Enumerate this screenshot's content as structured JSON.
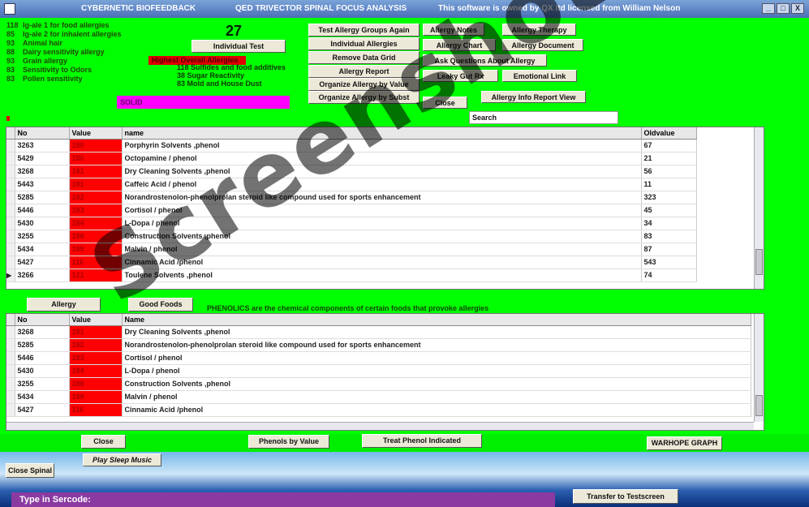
{
  "titlebar": {
    "app_name": "CYBERNETIC BIOFEEDBACK",
    "module": "QED   TRIVECTOR SPINAL FOCUS ANALYSIS",
    "license": "This software is owned by QX ltd licensed from William Nelson",
    "controls": [
      "_",
      "□",
      "X"
    ]
  },
  "stats": [
    {
      "num": "118",
      "label": "Ig-ale 1 for food allergies"
    },
    {
      "num": "85",
      "label": "Ig-ale 2 for inhalent allergies"
    },
    {
      "num": "93",
      "label": "Animal hair"
    },
    {
      "num": "88",
      "label": "Dairy sensitivity allergy"
    },
    {
      "num": "93",
      "label": "Grain allergy"
    },
    {
      "num": "83",
      "label": "Sensitivity to Odors"
    },
    {
      "num": "83",
      "label": "Pollen sensitivity"
    }
  ],
  "count": "27",
  "red_label": "Highest Overall Allergies",
  "subs": [
    {
      "num": "118",
      "label": "Sulfides and food additives"
    },
    {
      "num": "38",
      "label": "Sugar Reactivity"
    },
    {
      "num": "83",
      "label": "Mold and House Dust"
    }
  ],
  "magenta_text": "SOLID",
  "buttons": {
    "individual_test": "Individual Test",
    "test_allergy_groups": "Test Allergy Groups Again",
    "individual_allergies": "Individual Allergies",
    "remove_data_grid": "Remove Data Grid",
    "allergy_report": "Allergy Report",
    "organize_by_value": "Organize Allergy by Value",
    "organize_by_subst": "Organize Allergy by Subst",
    "allergy_notes": "Allergy Notes",
    "allergy_therapy": "Allergy Therapy",
    "allergy_chart": "Allergy Chart",
    "allergy_document": "Allergy Document",
    "ask_questions": "Ask Questions About Allergy",
    "leaky_gut": "Leaky Gut Rx",
    "emotional_link": "Emotional Link",
    "close_top": "Close",
    "allergy_info_report": "Allergy Info Report View",
    "allergy_tab": "Allergy",
    "good_foods_tab": "Good Foods",
    "close_bottom": "Close",
    "phenols_by_value": "Phenols by Value",
    "treat_phenol": "Treat Phenol Indicated",
    "warhope_graph": "WARHOPE GRAPH",
    "play_sleep_music": "Play Sleep Music",
    "close_spinal": "Close Spinal",
    "transfer": "Transfer to Testscreen"
  },
  "search": {
    "value": "Search"
  },
  "top_grid": {
    "headers": [
      "No",
      "Value",
      "name",
      "Oldvalue"
    ],
    "rows": [
      {
        "no": "3263",
        "value": "180",
        "name": "Porphyrin Solvents      ,phenol",
        "old": "67"
      },
      {
        "no": "5429",
        "value": "180",
        "name": "Octopamine /  phenol",
        "old": "21"
      },
      {
        "no": "3268",
        "value": "181",
        "name": "Dry Cleaning Solvents      ,phenol",
        "old": "56"
      },
      {
        "no": "5443",
        "value": "181",
        "name": "Caffeic Acid /  phenol",
        "old": "11"
      },
      {
        "no": "5285",
        "value": "182",
        "name": "Norandrostenolon-phenolprolan    steroid like compound used for sports enhancement",
        "old": "323"
      },
      {
        "no": "5446",
        "value": "183",
        "name": "Cortisol /  phenol",
        "old": "45"
      },
      {
        "no": "5430",
        "value": "184",
        "name": "L-Dopa /  phenol",
        "old": "34"
      },
      {
        "no": "3255",
        "value": "186",
        "name": "Construction Solvents      ,phenol",
        "old": "83"
      },
      {
        "no": "5434",
        "value": "189",
        "name": "Malvin /  phenol",
        "old": "87"
      },
      {
        "no": "5427",
        "value": "116",
        "name": "Cinnamic Acid /phenol",
        "old": "543"
      },
      {
        "no": "3266",
        "value": "121",
        "name": "Toulene Solvents      ,phenol",
        "old": "74"
      }
    ]
  },
  "phenolics_msg": "PHENOLICS are the chemical components of certain foods that provoke allergies",
  "bottom_grid": {
    "headers": [
      "No",
      "Value",
      "Name"
    ],
    "rows": [
      {
        "no": "3268",
        "value": "181",
        "name": "Dry Cleaning Solvents      ,phenol"
      },
      {
        "no": "5285",
        "value": "182",
        "name": "Norandrostenolon-phenolprolan    steroid like compound used for sports enhancement"
      },
      {
        "no": "5446",
        "value": "183",
        "name": "Cortisol /  phenol"
      },
      {
        "no": "5430",
        "value": "184",
        "name": "L-Dopa /  phenol"
      },
      {
        "no": "3255",
        "value": "186",
        "name": "Construction Solvents      ,phenol"
      },
      {
        "no": "5434",
        "value": "189",
        "name": "Malvin /  phenol"
      },
      {
        "no": "5427",
        "value": "116",
        "name": "Cinnamic Acid /phenol"
      }
    ]
  },
  "sercode_label": "Type in Sercode:",
  "watermark": "Screenshot"
}
